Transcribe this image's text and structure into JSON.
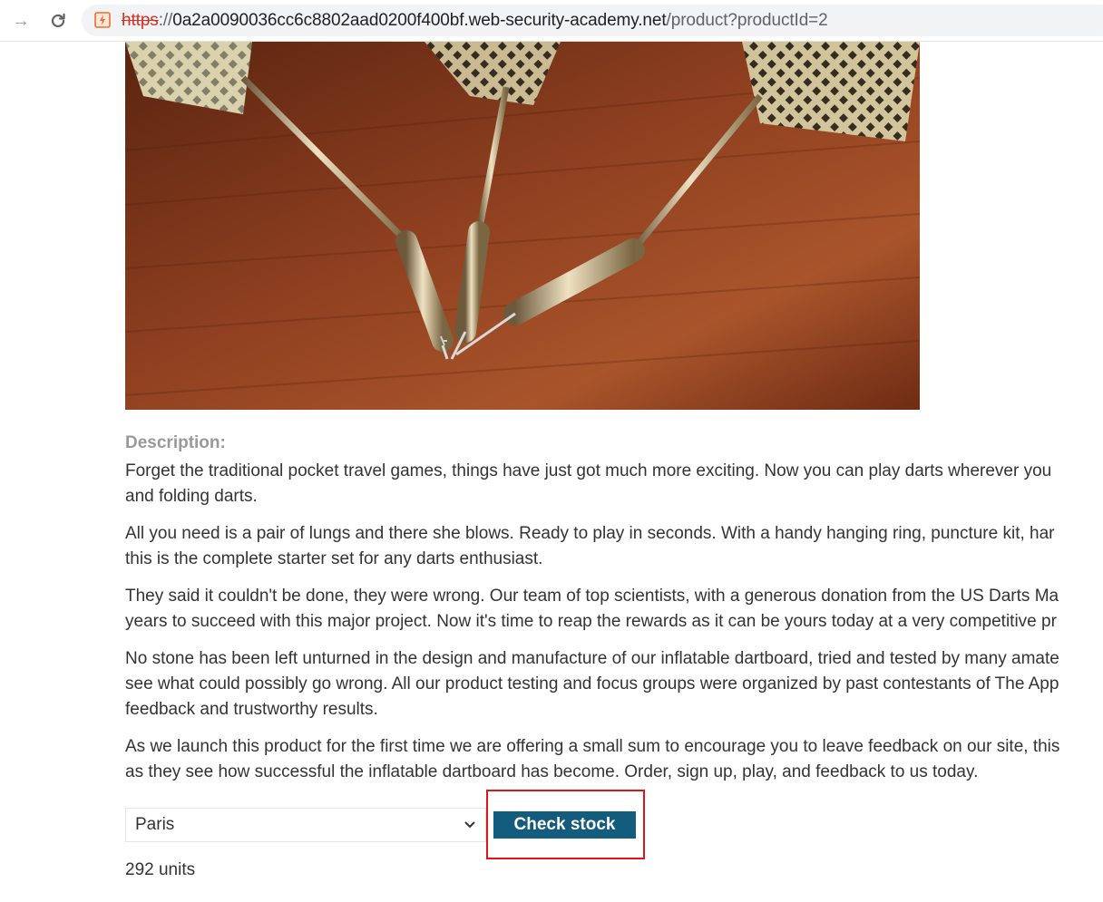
{
  "browser": {
    "url": {
      "scheme": "https",
      "separator": "://",
      "host": "0a2a0090036cc6c8802aad0200f400bf.web-security-academy.net",
      "path": "/product?productId=2"
    },
    "icons": {
      "forward": "arrow-right-icon",
      "reload": "reload-icon",
      "site": "lab-site-icon"
    }
  },
  "product": {
    "image_subject": "three darts on a wooden surface",
    "description_label": "Description:",
    "paragraphs": [
      [
        "Forget the traditional pocket travel games, things have just got much more exciting. Now you can play darts wherever you",
        "and folding darts."
      ],
      [
        "All you need is a pair of lungs and there she blows. Ready to play in seconds. With a handy hanging ring, puncture kit, har",
        "this is the complete starter set for any darts enthusiast."
      ],
      [
        "They said it couldn't be done, they were wrong. Our team of top scientists, with a generous donation from the US Darts Ma",
        "years to succeed with this major project. Now it's time to reap the rewards as it can be yours today at a very competitive pr"
      ],
      [
        "No stone has been left unturned in the design and manufacture of our inflatable dartboard, tried and tested by many amate",
        "see what could possibly go wrong. All our product testing and focus groups were organized by past contestants of The App",
        "feedback and trustworthy results."
      ],
      [
        "As we launch this product for the first time we are offering a small sum to encourage you to leave feedback on our site, this",
        "as they see how successful the inflatable dartboard has become. Order, sign up, play, and feedback to us today."
      ]
    ]
  },
  "stock": {
    "selected_store": "Paris",
    "button_label": "Check stock",
    "result": "292 units",
    "colors": {
      "button_bg": "#145c7e",
      "highlight": "#e0131a"
    }
  }
}
